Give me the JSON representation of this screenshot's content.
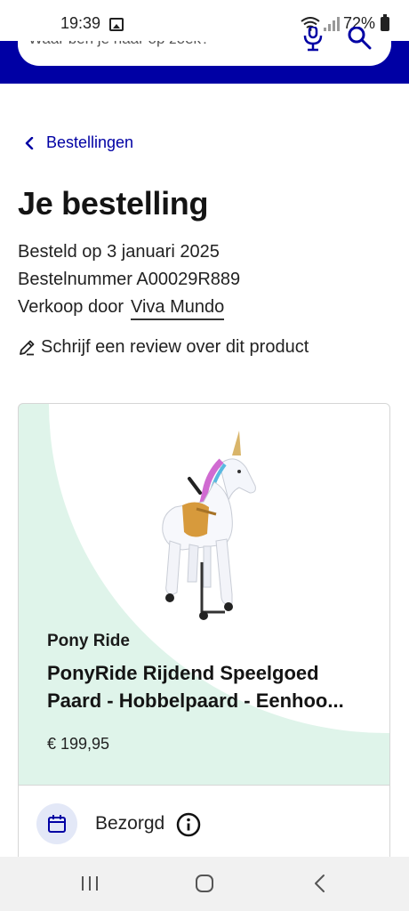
{
  "status_bar": {
    "time": "19:39",
    "battery": "72%"
  },
  "search": {
    "placeholder": "Waar ben je naar op zoek?"
  },
  "breadcrumb": {
    "label": "Bestellingen"
  },
  "order": {
    "title": "Je bestelling",
    "date": "Besteld op 3 januari 2025",
    "number": "Bestelnummer A00029R889",
    "seller_prefix": "Verkoop door",
    "seller_name": "Viva Mundo",
    "review_label": "Schrijf een review over dit product"
  },
  "product": {
    "brand": "Pony Ride",
    "title": "PonyRide Rijdend Speelgoed Paard - Hobbelpaard - Eenhoo...",
    "price": "€ 199,95",
    "status": "Bezorgd"
  },
  "colors": {
    "header": "#0000a4",
    "link": "#0000a4",
    "card_accent": "#dff4ea",
    "status_icon_bg": "#e3e8f7"
  },
  "icons": {
    "gallery": "gallery-icon",
    "wifi": "wifi-icon",
    "signal": "signal-icon",
    "battery": "battery-icon",
    "mic": "mic-icon",
    "search": "search-icon",
    "back": "chevron-left-icon",
    "review": "pencil-icon",
    "status": "calendar-icon",
    "info": "info-icon",
    "nav_recent": "recent-apps-icon",
    "nav_home": "home-icon",
    "nav_back": "back-icon"
  }
}
